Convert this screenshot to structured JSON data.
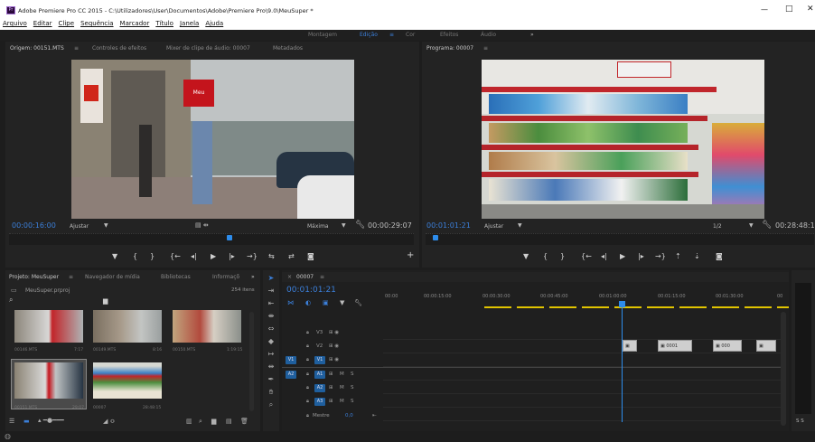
{
  "window": {
    "title": "Adobe Premiere Pro CC 2015 - C:\\Utilizadores\\User\\Documentos\\Adobe\\Premiere Pro\\9.0\\MeuSuper *",
    "min": "—",
    "max": "□",
    "close": "✕"
  },
  "menu": [
    "Arquivo",
    "Editar",
    "Clipe",
    "Sequência",
    "Marcador",
    "Título",
    "Janela",
    "Ajuda"
  ],
  "workspaces": {
    "montagem": "Montagem",
    "edicao": "Edição",
    "cor": "Cor",
    "efeitos": "Efeitos",
    "audio": "Áudio",
    "more": "»"
  },
  "source": {
    "tabs": [
      "Origem: 00151.MTS",
      "Controles de efeitos",
      "Mixer de clipe de áudio: 00007",
      "Metadados"
    ],
    "timecode": "00:00:16:00",
    "fit": "Ajustar",
    "quality": "Máxima",
    "duration": "00:00:29:07",
    "add": "+"
  },
  "program": {
    "tab": "Programa: 00007",
    "timecode": "00:01:01:21",
    "fit": "Ajustar",
    "quality": "1/2",
    "duration": "00:28:48:1"
  },
  "project": {
    "tabs": [
      "Projeto: MeuSuper",
      "Navegador de mídia",
      "Bibliotecas",
      "Informaçõ"
    ],
    "file": "MeuSuper.prproj",
    "count": "254 itens",
    "search": "",
    "items": [
      {
        "name": "00146.MTS",
        "dur": "7:17"
      },
      {
        "name": "00149.MTS",
        "dur": "8:16"
      },
      {
        "name": "00150.MTS",
        "dur": "1:19:15"
      },
      {
        "name": "00151.MTS",
        "dur": "29:07"
      },
      {
        "name": "00007",
        "dur": "28:48:15"
      }
    ]
  },
  "timeline": {
    "tab": "00007",
    "timecode": "00:01:01:21",
    "ruler": [
      "00:00",
      "00:00:15:00",
      "00:00:30:00",
      "00:00:45:00",
      "00:01:00:00",
      "00:01:15:00",
      "00:01:30:00",
      "00"
    ],
    "video": [
      {
        "name": "V3"
      },
      {
        "name": "V2"
      },
      {
        "name": "V1",
        "src": "V1"
      }
    ],
    "audio": [
      {
        "name": "A1",
        "src": "A2",
        "m": "M",
        "s": "S"
      },
      {
        "name": "A2",
        "m": "M",
        "s": "S"
      },
      {
        "name": "A3",
        "m": "M",
        "s": "S"
      }
    ],
    "master": {
      "label": "Mestre",
      "value": "0,0"
    },
    "clips": [
      "",
      "0001",
      "000",
      ""
    ],
    "meter": "S S"
  },
  "colors": {
    "accent": "#2d8ceb",
    "selection": "#1f5f9e"
  }
}
